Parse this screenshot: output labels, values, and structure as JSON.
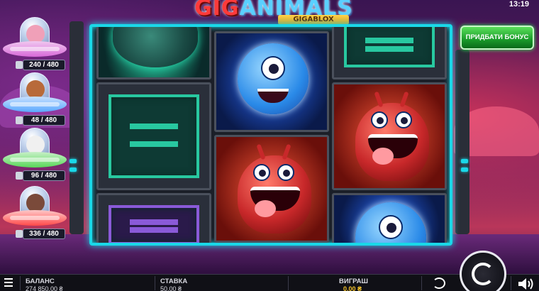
{
  "header": {
    "logo_red": "GIG",
    "logo_blue": "ANIMALS",
    "logo_sub": "GIGABLOX",
    "clock": "13:19"
  },
  "bonus_button": {
    "label": "ПРИДБАТИ БОНУС"
  },
  "ufos": [
    {
      "counter": "240 / 480",
      "pilot": "pig-alien",
      "color": "#d86ad8"
    },
    {
      "counter": "48 / 480",
      "pilot": "monkey-alien",
      "color": "#5aa8ff"
    },
    {
      "counter": "96 / 480",
      "pilot": "sheep-alien",
      "color": "#5ad85a"
    },
    {
      "counter": "336 / 480",
      "pilot": "bull-alien",
      "color": "#ff4a4a"
    }
  ],
  "reels": {
    "cells": [
      {
        "symbol": "green-alien-icon"
      },
      {
        "symbol": "blue-alien-icon"
      },
      {
        "symbol": "green-block-icon"
      },
      {
        "symbol": "green-block-icon"
      },
      {
        "symbol": "red-alien-icon"
      },
      {
        "symbol": "red-alien-icon"
      },
      {
        "symbol": "purple-block-icon"
      },
      {
        "symbol": "blue-alien-icon"
      }
    ]
  },
  "bottom_bar": {
    "balance_label": "БАЛАНС",
    "balance_value": "274 850,00 ₴",
    "bet_label": "СТАВКА",
    "bet_value": "50,00 ₴",
    "win_label": "ВИГРАШ",
    "win_value": "0,00 ₴"
  },
  "colors": {
    "frame_accent": "#1ad8e8",
    "bonus_green": "#1a9a2a",
    "win_gold": "#f2c12a"
  }
}
